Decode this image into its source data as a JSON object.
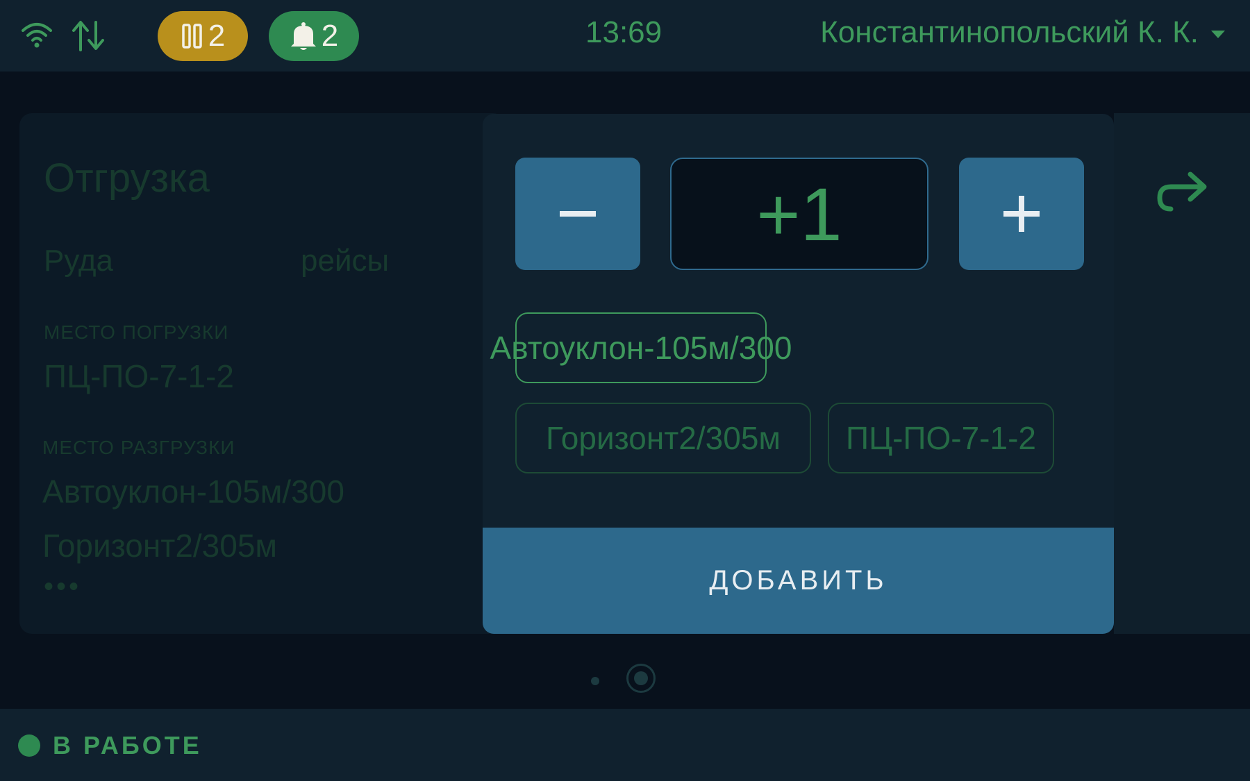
{
  "topbar": {
    "icons": [
      "wifi-icon",
      "data-transfer-icon",
      "pause-icon",
      "bell-icon"
    ],
    "pause_count": "2",
    "notifications_count": "2",
    "time": "13:69",
    "user_name": "Константинопольский К. К."
  },
  "background_card": {
    "title": "Отгрузка",
    "cargo": "Руда",
    "trips_label": "рейсы",
    "loading_label": "МЕСТО ПОГРУЗКИ",
    "loading_value": "ПЦ-ПО-7-1-2",
    "unloading_label": "МЕСТО РАЗГРУЗКИ",
    "unloading_values": [
      "Автоуклон-105м/300",
      "Горизонт2/305м"
    ],
    "more": "•••"
  },
  "modal": {
    "stepper_value": "+1",
    "chips": [
      {
        "label": "Автоуклон-105м/300",
        "selected": true
      },
      {
        "label": "Горизонт2/305м",
        "selected": false
      },
      {
        "label": "ПЦ-ПО-7-1-2",
        "selected": false
      }
    ],
    "add_label": "ДОБАВИТЬ"
  },
  "pagination": {
    "pages": 2,
    "current": 2
  },
  "status": {
    "label": "В РАБОТЕ",
    "color": "#2e8a51"
  },
  "colors": {
    "accent_green": "#3e9a5c",
    "button_blue": "#2d698c",
    "pause_yellow": "#b9901c"
  }
}
